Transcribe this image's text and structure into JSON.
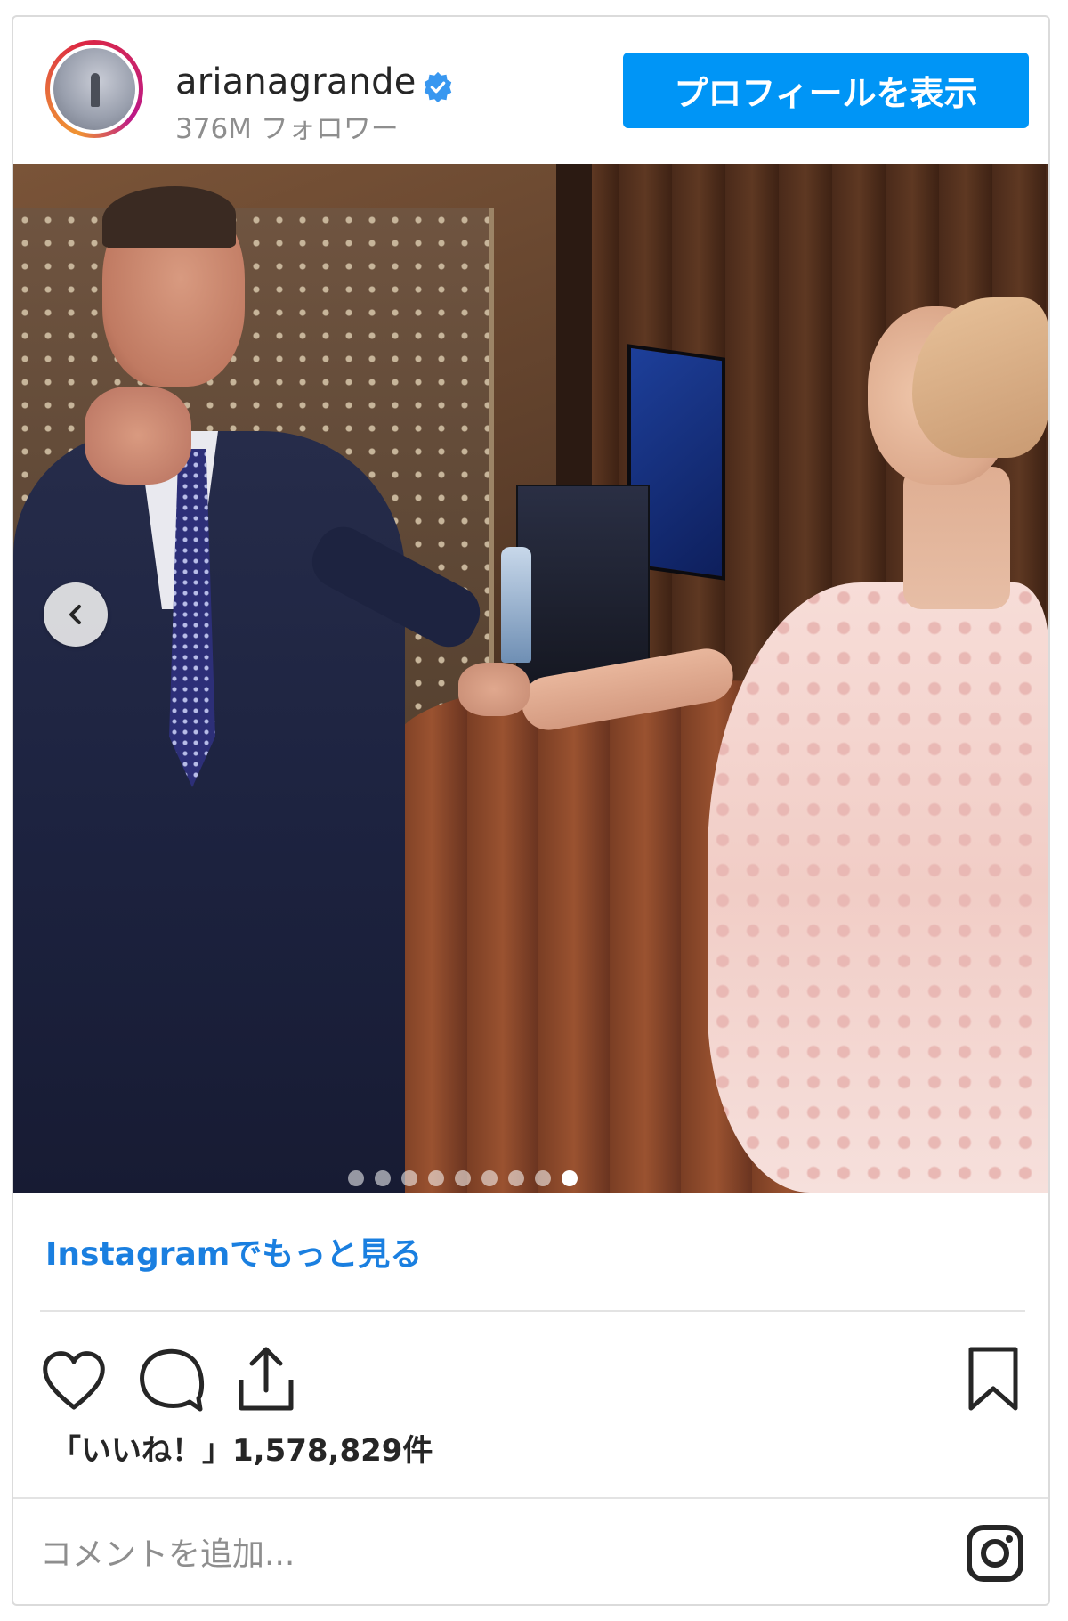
{
  "header": {
    "username": "arianagrande",
    "followers": "376M フォロワー",
    "profile_button": "プロフィールを表示"
  },
  "carousel": {
    "total": 9,
    "current": 9
  },
  "footer": {
    "more_link": "Instagramでもっと見る",
    "likes": "「いいね！」1,578,829件",
    "comment_placeholder": "コメントを追加..."
  },
  "colors": {
    "accent": "#0095f6",
    "link": "#1a7fe0",
    "text": "#262626",
    "muted": "#8e8e8e"
  },
  "icons": [
    "verified-badge-icon",
    "chevron-left-icon",
    "heart-icon",
    "comment-icon",
    "share-icon",
    "bookmark-icon",
    "instagram-icon"
  ]
}
